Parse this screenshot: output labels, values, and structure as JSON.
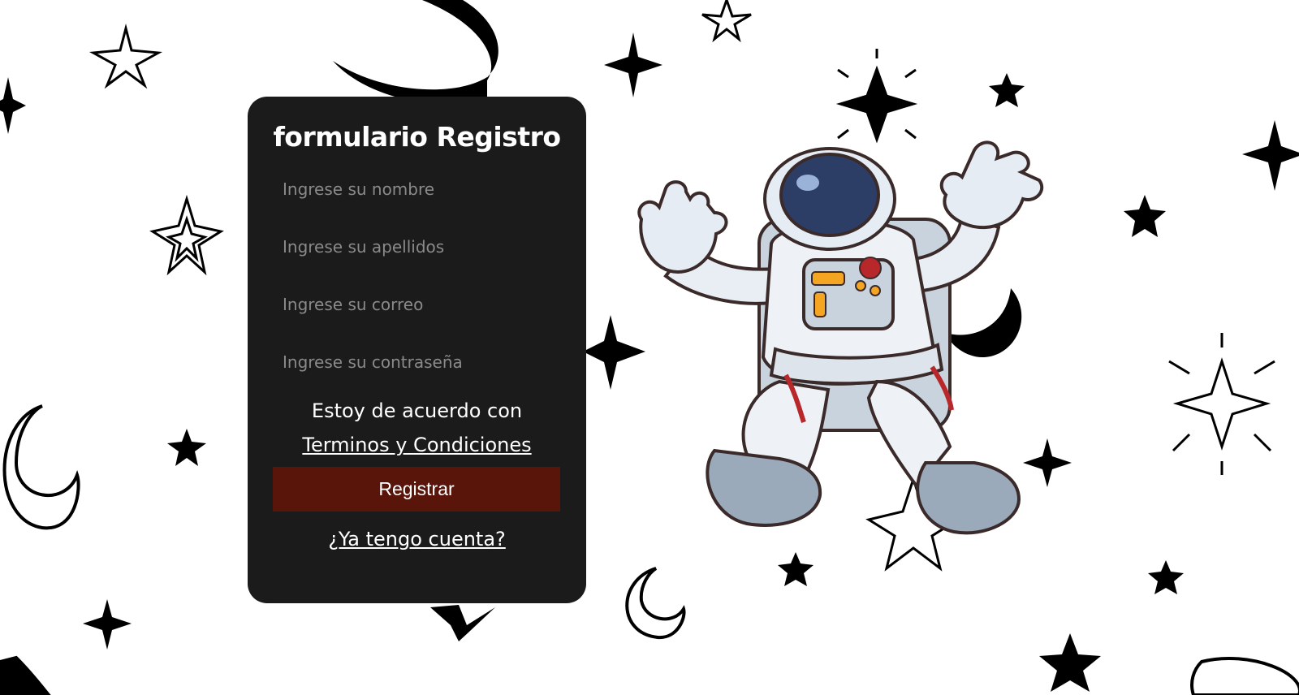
{
  "form": {
    "title": "formulario Registro",
    "fields": [
      {
        "placeholder": "Ingrese su nombre",
        "value": ""
      },
      {
        "placeholder": "Ingrese su apellidos",
        "value": ""
      },
      {
        "placeholder": "Ingrese su correo",
        "value": ""
      },
      {
        "placeholder": "Ingrese su contraseña",
        "value": ""
      }
    ],
    "terms_text": "Estoy de acuerdo con",
    "terms_link": "Terminos y Condiciones",
    "submit_label": "Registrar",
    "login_link": "¿Ya tengo cuenta?"
  },
  "colors": {
    "card_background": "#1b1b1b",
    "button_background": "#5a150b",
    "page_background": "#ffffff"
  },
  "background": {
    "pattern": "hand-drawn stars and crescent moons",
    "illustration": "floating astronaut"
  }
}
